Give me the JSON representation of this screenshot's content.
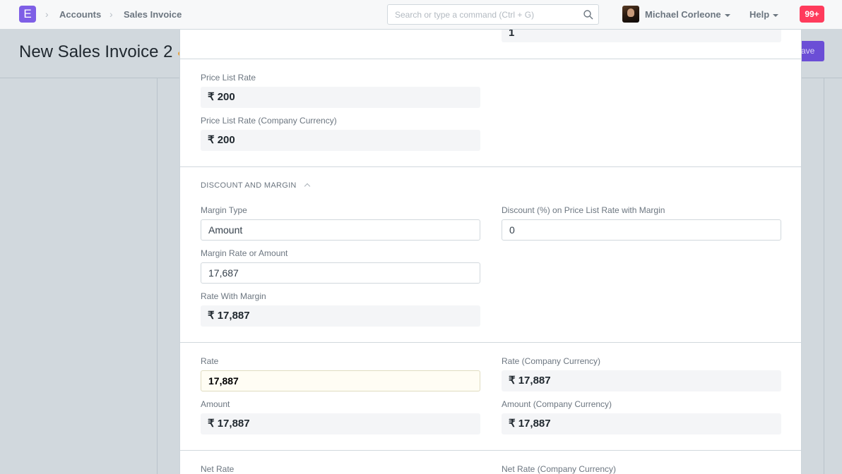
{
  "navbar": {
    "logo": "E",
    "breadcrumbs": [
      "Accounts",
      "Sales Invoice"
    ],
    "search_placeholder": "Search or type a command (Ctrl + G)",
    "user_name": "Michael Corleone",
    "help_label": "Help",
    "notification_count": "99+"
  },
  "page": {
    "title": "New Sales Invoice 2",
    "save_label": "ave"
  },
  "modal": {
    "top_field_value": "1",
    "price_list_rate_label": "Price List Rate",
    "price_list_rate_value": "₹ 200",
    "price_list_rate_company_label": "Price List Rate (Company Currency)",
    "price_list_rate_company_value": "₹ 200",
    "discount_section_title": "DISCOUNT AND MARGIN",
    "margin_type_label": "Margin Type",
    "margin_type_value": "Amount",
    "discount_label": "Discount (%) on Price List Rate with Margin",
    "discount_value": "0",
    "margin_rate_label": "Margin Rate or Amount",
    "margin_rate_value": "17,687",
    "rate_with_margin_label": "Rate With Margin",
    "rate_with_margin_value": "₹ 17,887",
    "rate_label": "Rate",
    "rate_value": "17,887",
    "rate_company_label": "Rate (Company Currency)",
    "rate_company_value": "₹ 17,887",
    "amount_label": "Amount",
    "amount_value": "₹ 17,887",
    "amount_company_label": "Amount (Company Currency)",
    "amount_company_value": "₹ 17,887",
    "net_rate_label": "Net Rate",
    "net_rate_company_label": "Net Rate (Company Currency)"
  }
}
